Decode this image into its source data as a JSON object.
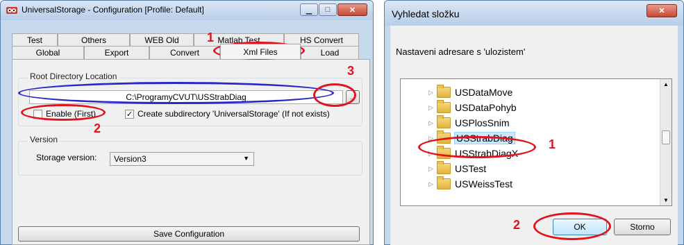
{
  "left": {
    "title": "UniversalStorage - Configuration [Profile: Default]",
    "tabs_row1": [
      "Test",
      "Others",
      "WEB Old",
      "Matlab Test",
      "HS Convert"
    ],
    "tabs_row2": [
      "Global",
      "Export",
      "Convert",
      "Xml Files",
      "Load"
    ],
    "root_group_title": "Root Directory Location",
    "path_value": "C:\\ProgramyCVUT\\USStrabDiag",
    "browse_label": "...",
    "enable_label": "Enable (First)",
    "create_subdir_label": "Create subdirectory 'UniversalStorage' (If not exists)",
    "create_subdir_checked": "✓",
    "version_group_title": "Version",
    "storage_version_label": "Storage version:",
    "storage_version_value": "Version3",
    "save_label": "Save Configuration",
    "annotations": [
      "1",
      "2",
      "3"
    ]
  },
  "right": {
    "title": "Vyhledat složku",
    "description": "Nastaveni adresare s 'ulozistem'",
    "folders": [
      "USDataMove",
      "USDataPohyb",
      "USPlosSnim",
      "USStrabDiag",
      "USStrabDiagX",
      "USTest",
      "USWeissTest"
    ],
    "selected_folder": "USStrabDiag",
    "ok_label": "OK",
    "cancel_label": "Storno",
    "annotations": [
      "1",
      "2"
    ]
  },
  "colors": {
    "annotation_red": "#e0141e",
    "annotation_blue": "#2828c8",
    "selection": "#cce8ff"
  }
}
